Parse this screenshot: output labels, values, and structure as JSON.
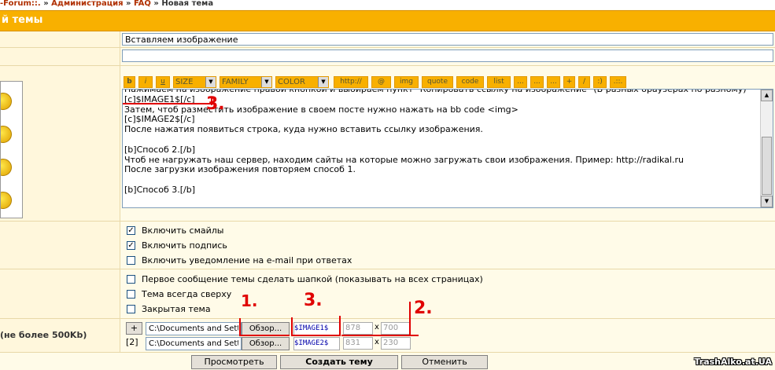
{
  "breadcrumb": {
    "forum": "-Forum::.",
    "sep1": " » ",
    "admin": "Администрация",
    "sep2": " » ",
    "faq": "FAQ",
    "sep3": " » ",
    "current": "Новая тема"
  },
  "header": {
    "title": "й темы"
  },
  "form": {
    "subject_value": "Вставляем изображение",
    "description_value": "",
    "attach_label": "(не более 500Kb)"
  },
  "toolbar": {
    "bold": "b",
    "italic": "i",
    "underline": "u",
    "size_label": "SIZE",
    "family_label": "FAMILY",
    "color_label": "COLOR",
    "http": "http://",
    "email": "@",
    "img": "img",
    "quote": "quote",
    "code": "code",
    "list": "list",
    "more1": "...",
    "more2": "...",
    "more3": "...",
    "plus": "+",
    "slash": "/",
    "smile": ":)",
    "dots": ".::."
  },
  "editor": {
    "text": "Нажимаем на изображение правой кнопкой и выбираем пункт \"Копировать ссылку на изображение\" (В разных браузерах по разному)\n[c]$IMAGE1$[/c]\nЗатем, чтоб разместить изображение в своем посте нужно нажать на bb code <img>\n[c]$IMAGE2$[/c]\nПосле нажатия появиться строка, куда нужно вставить ссылку изображения.\n\n[b]Способ 2.[/b]\nЧтоб не нагружать наш сервер, находим сайты на которые можно загружать свои изображения. Пример: http://radikal.ru\nПосле загрузки изображения повторяем способ 1.\n\n[b]Способ 3.[/b]"
  },
  "options": {
    "smilies": "Включить смайлы",
    "signature": "Включить подпись",
    "notify": "Включить уведомление на e-mail при ответах",
    "sticky_first": "Первое сообщение темы сделать шапкой (показывать на всех страницах)",
    "pinned": "Тема всегда сверху",
    "closed": "Закрытая тема"
  },
  "attachments": {
    "add": "+",
    "index2": "[2]",
    "file1_path": "C:\\Documents and Setti",
    "file2_path": "C:\\Documents and Setti",
    "browse": "Обзор...",
    "tag1": "$IMAGE1$",
    "tag2": "$IMAGE2$",
    "w1": "878",
    "h1": "700",
    "w2": "831",
    "h2": "230",
    "x": "x"
  },
  "annotations": {
    "n1": "1.",
    "n2": "2.",
    "n3": "3.",
    "n3b": "3."
  },
  "buttons": {
    "preview": "Просмотреть",
    "submit": "Создать тему",
    "cancel": "Отменить"
  },
  "watermark": "TrashAlko.at.UA",
  "colors": {
    "header": "#f8b000",
    "accent_red": "#e00000",
    "link": "#b03000"
  }
}
